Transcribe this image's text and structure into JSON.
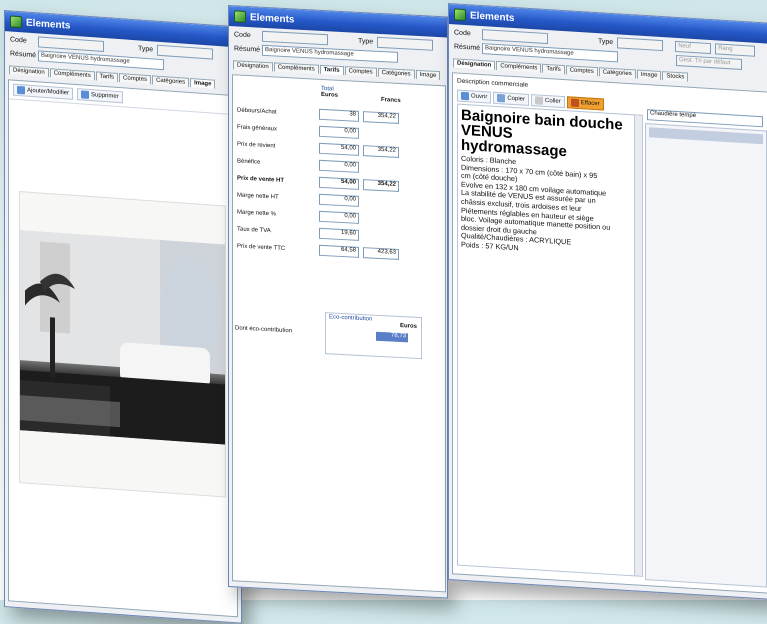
{
  "window_title": "Elements",
  "labels": {
    "code": "Code",
    "type": "Type",
    "resume": "Résumé"
  },
  "resume_value": "Baignoire VENUS hydromassage",
  "w3_right_fields": [
    "Neuf",
    "Rang",
    "Gest. Tri par défaut"
  ],
  "tabs": [
    "Désignation",
    "Compléments",
    "Tarifs",
    "Comptes",
    "Catégories",
    "Image",
    "Stocks"
  ],
  "w1": {
    "toolbar": [
      "Ajouter/Modifier",
      "Supprimer"
    ]
  },
  "w2": {
    "col_headers": {
      "total": "Total",
      "euros": "Euros",
      "francs": "Francs"
    },
    "rows": [
      {
        "label": "Débours/Achat",
        "euros": "38",
        "francs": "354,22",
        "bold": false
      },
      {
        "label": "Frais généraux",
        "euros": "0,00",
        "francs": "",
        "bold": false
      },
      {
        "label": "Prix de revient",
        "euros": "54,00",
        "francs": "354,22",
        "bold": false
      },
      {
        "label": "Bénéfice",
        "euros": "0,00",
        "francs": "",
        "bold": false
      },
      {
        "label": "Prix de vente HT",
        "euros": "54,00",
        "francs": "354,22",
        "bold": true
      },
      {
        "label": "Marge nette HT",
        "euros": "0,00",
        "francs": "",
        "bold": false
      },
      {
        "label": "Marge nette %",
        "euros": "0,00",
        "francs": "",
        "bold": false
      },
      {
        "label": "Taux de TVA",
        "euros": "19,60",
        "francs": "",
        "bold": false
      },
      {
        "label": "Prix de vente TTC",
        "euros": "64,58",
        "francs": "423,63",
        "bold": false
      }
    ],
    "eco_label": "Dont éco-contribution",
    "eco_title": "Eco-contribution",
    "eco_value": "78,73"
  },
  "w3": {
    "section_label": "Description commerciale",
    "toolbar": [
      "Ouvrir",
      "Copier",
      "Coller",
      "Effacer"
    ],
    "title_line1": "Baignoire bain douche VENUS",
    "title_line2": "hydromassage",
    "lines": [
      "Coloris : Blanche",
      "Dimensions : 170 x 70 cm (côté bain) x 95",
      "cm (côté douche)",
      "Evolve en 132 x 180 cm voilage automatique",
      "La stabilité de VENUS est assurée par un",
      "châssis exclusif, trois ardoises et leur",
      "Piétements réglables en hauteur et siège",
      "bloc. Voilage automatique manette position ou",
      "dossier droit du gauche",
      "Qualité/Chaudières : ACRYLIQUE",
      "Poids : 57 KG/UN"
    ],
    "side_panel_value": "Chaudière tempé"
  },
  "colors": {
    "titlebar": "#2557c7",
    "window_bg": "#eef0f4",
    "accent_orange": "#f0a030"
  }
}
